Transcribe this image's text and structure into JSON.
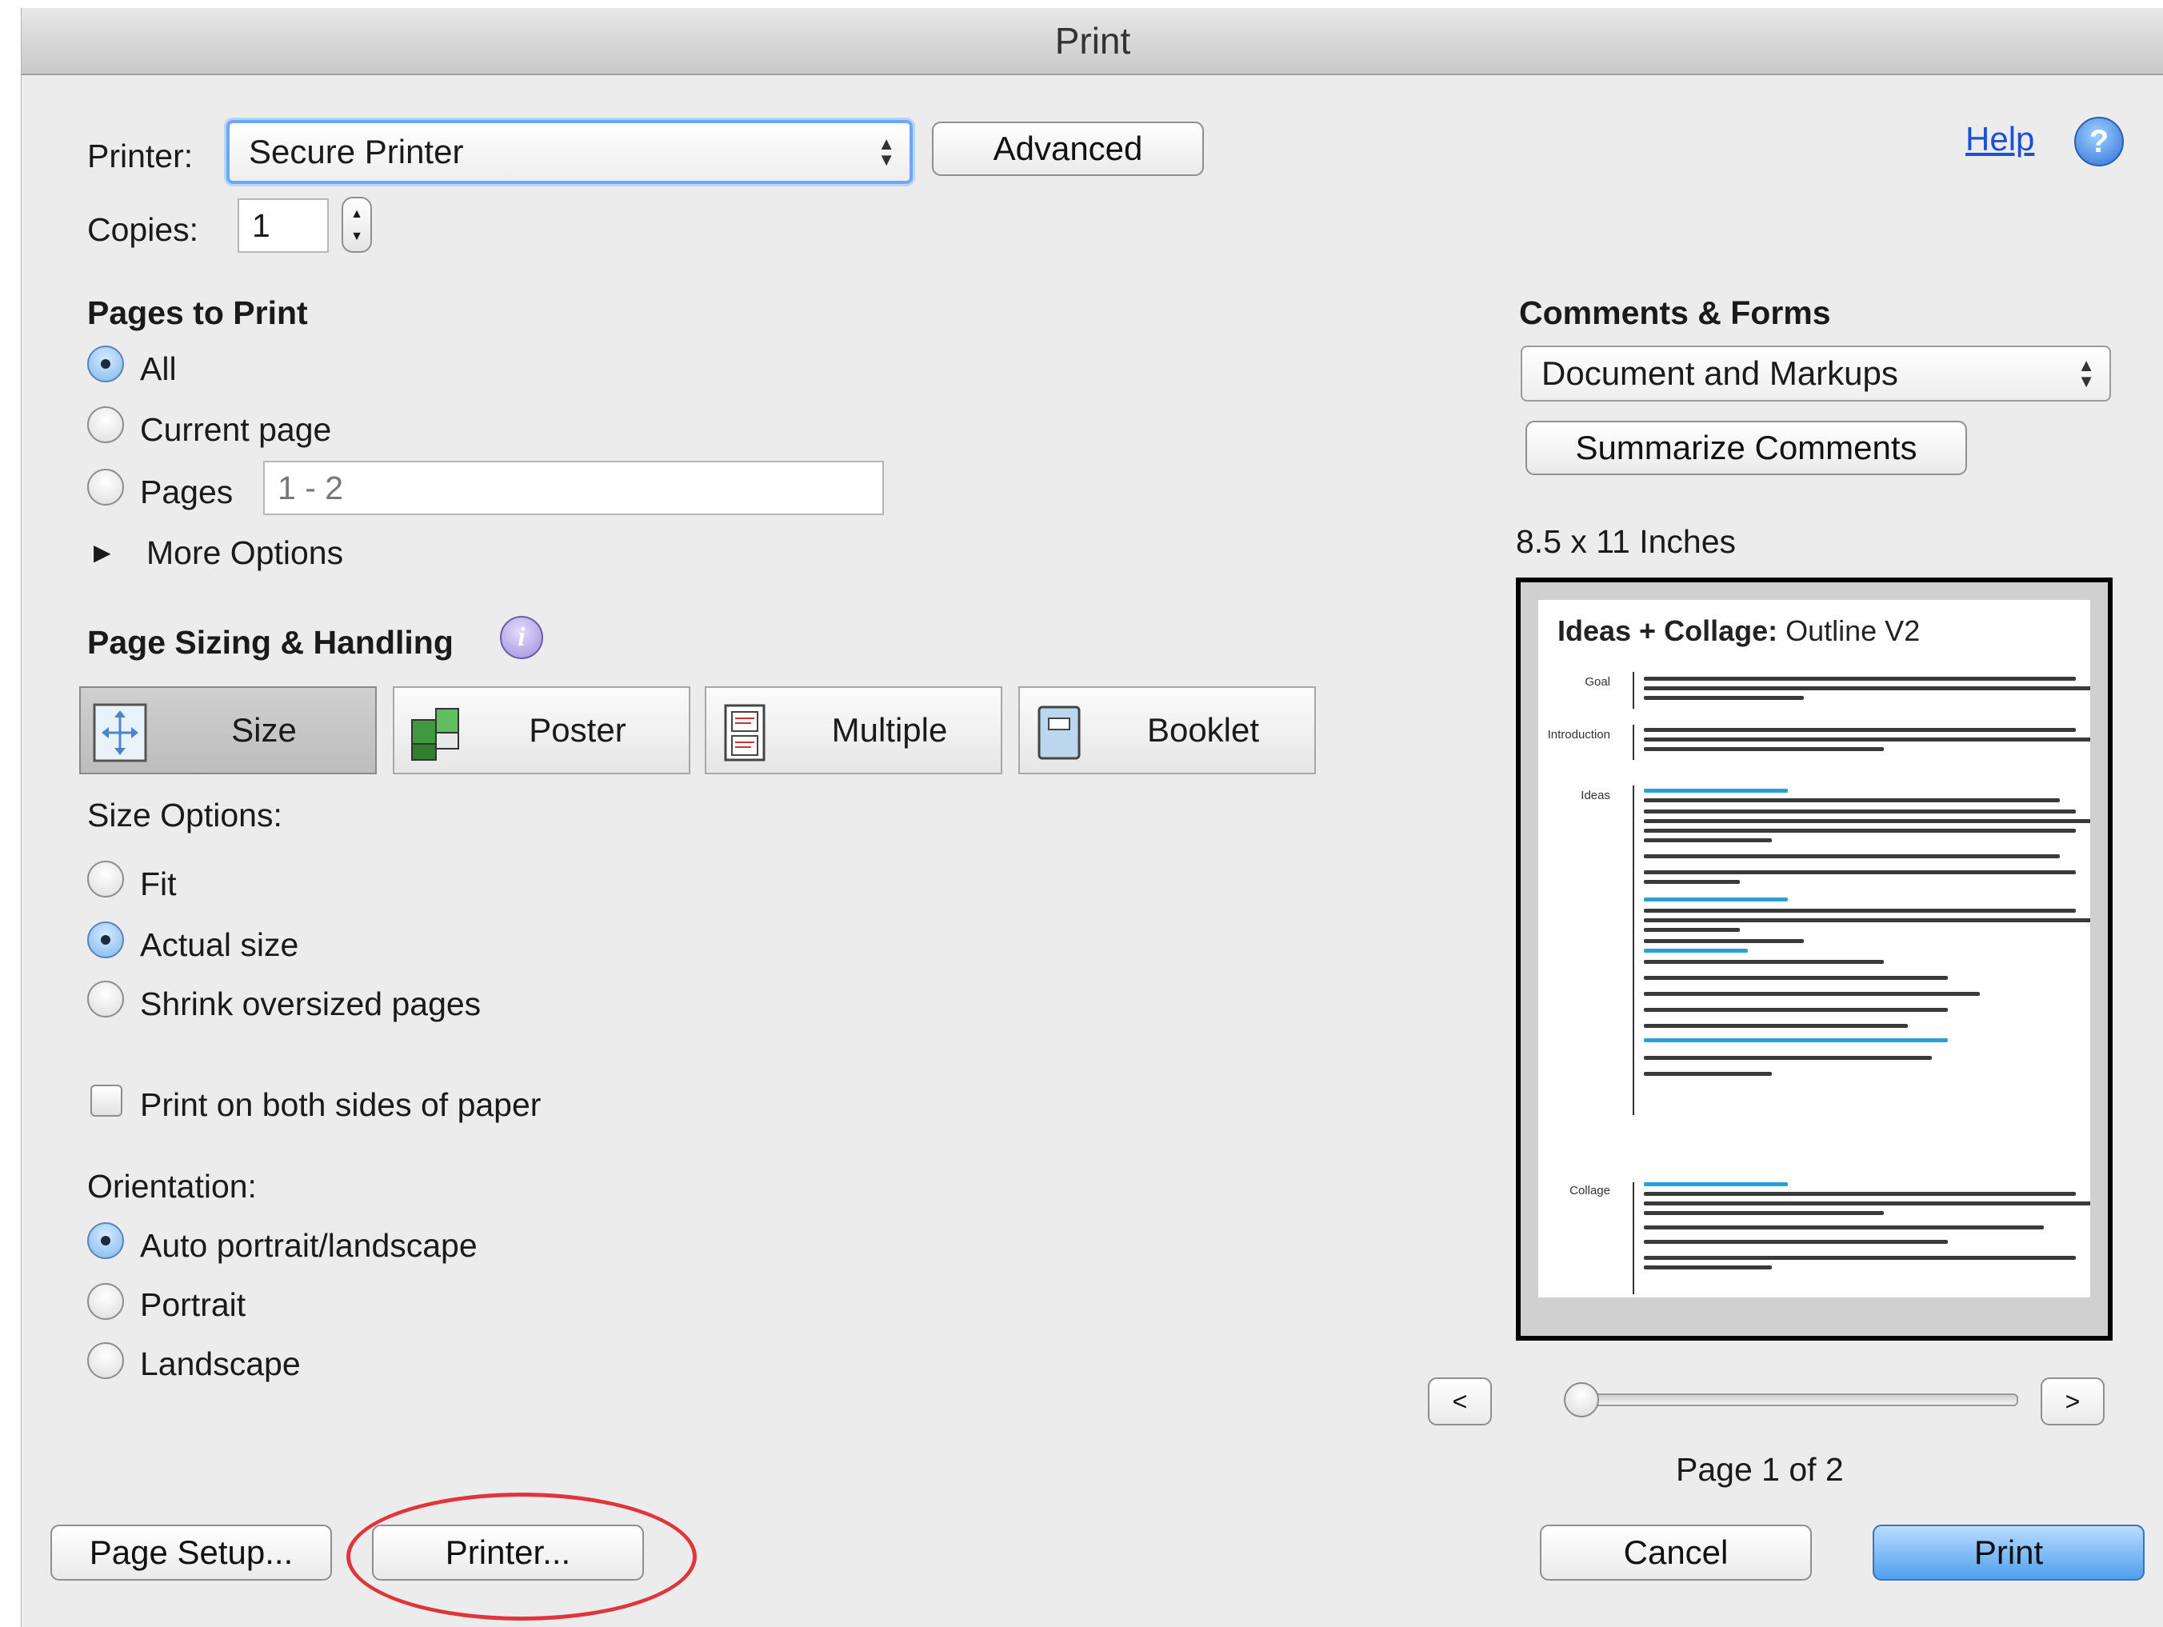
{
  "window": {
    "title": "Print"
  },
  "printer": {
    "label": "Printer:",
    "value": "Secure Printer",
    "advanced_label": "Advanced"
  },
  "help": {
    "label": "Help",
    "icon": "help-icon"
  },
  "copies": {
    "label": "Copies:",
    "value": "1"
  },
  "pages_to_print": {
    "heading": "Pages to Print",
    "all_label": "All",
    "current_label": "Current page",
    "pages_label": "Pages",
    "pages_value": "1 - 2",
    "selected": "All",
    "more_options_label": "More Options"
  },
  "page_sizing": {
    "heading": "Page Sizing & Handling",
    "modes": [
      {
        "label": "Size",
        "icon": "size-icon"
      },
      {
        "label": "Poster",
        "icon": "poster-icon"
      },
      {
        "label": "Multiple",
        "icon": "multiple-icon"
      },
      {
        "label": "Booklet",
        "icon": "booklet-icon"
      }
    ],
    "active_mode": "Size",
    "size_options_label": "Size Options:",
    "fit_label": "Fit",
    "actual_label": "Actual size",
    "shrink_label": "Shrink oversized pages",
    "selected_size": "Actual size",
    "duplex_label": "Print on both sides of paper",
    "duplex_checked": false
  },
  "orientation": {
    "label": "Orientation:",
    "auto_label": "Auto portrait/landscape",
    "portrait_label": "Portrait",
    "landscape_label": "Landscape",
    "selected": "Auto portrait/landscape"
  },
  "comments_forms": {
    "heading": "Comments & Forms",
    "value": "Document and Markups",
    "summarize_label": "Summarize Comments"
  },
  "preview": {
    "paper_size": "8.5 x 11 Inches",
    "doc_title_bold": "Ideas + Collage:",
    "doc_title_rest": " Outline V2",
    "sections": [
      "Goal",
      "Introduction",
      "Ideas",
      "Collage"
    ],
    "prev_label": "<",
    "next_label": ">",
    "page_status": "Page 1 of 2",
    "slider_position": 0
  },
  "footer": {
    "page_setup_label": "Page Setup...",
    "printer_label": "Printer...",
    "cancel_label": "Cancel",
    "print_label": "Print"
  },
  "colors": {
    "accent": "#4f9fef",
    "highlight": "#e0353a",
    "link": "#1f4fd6"
  }
}
